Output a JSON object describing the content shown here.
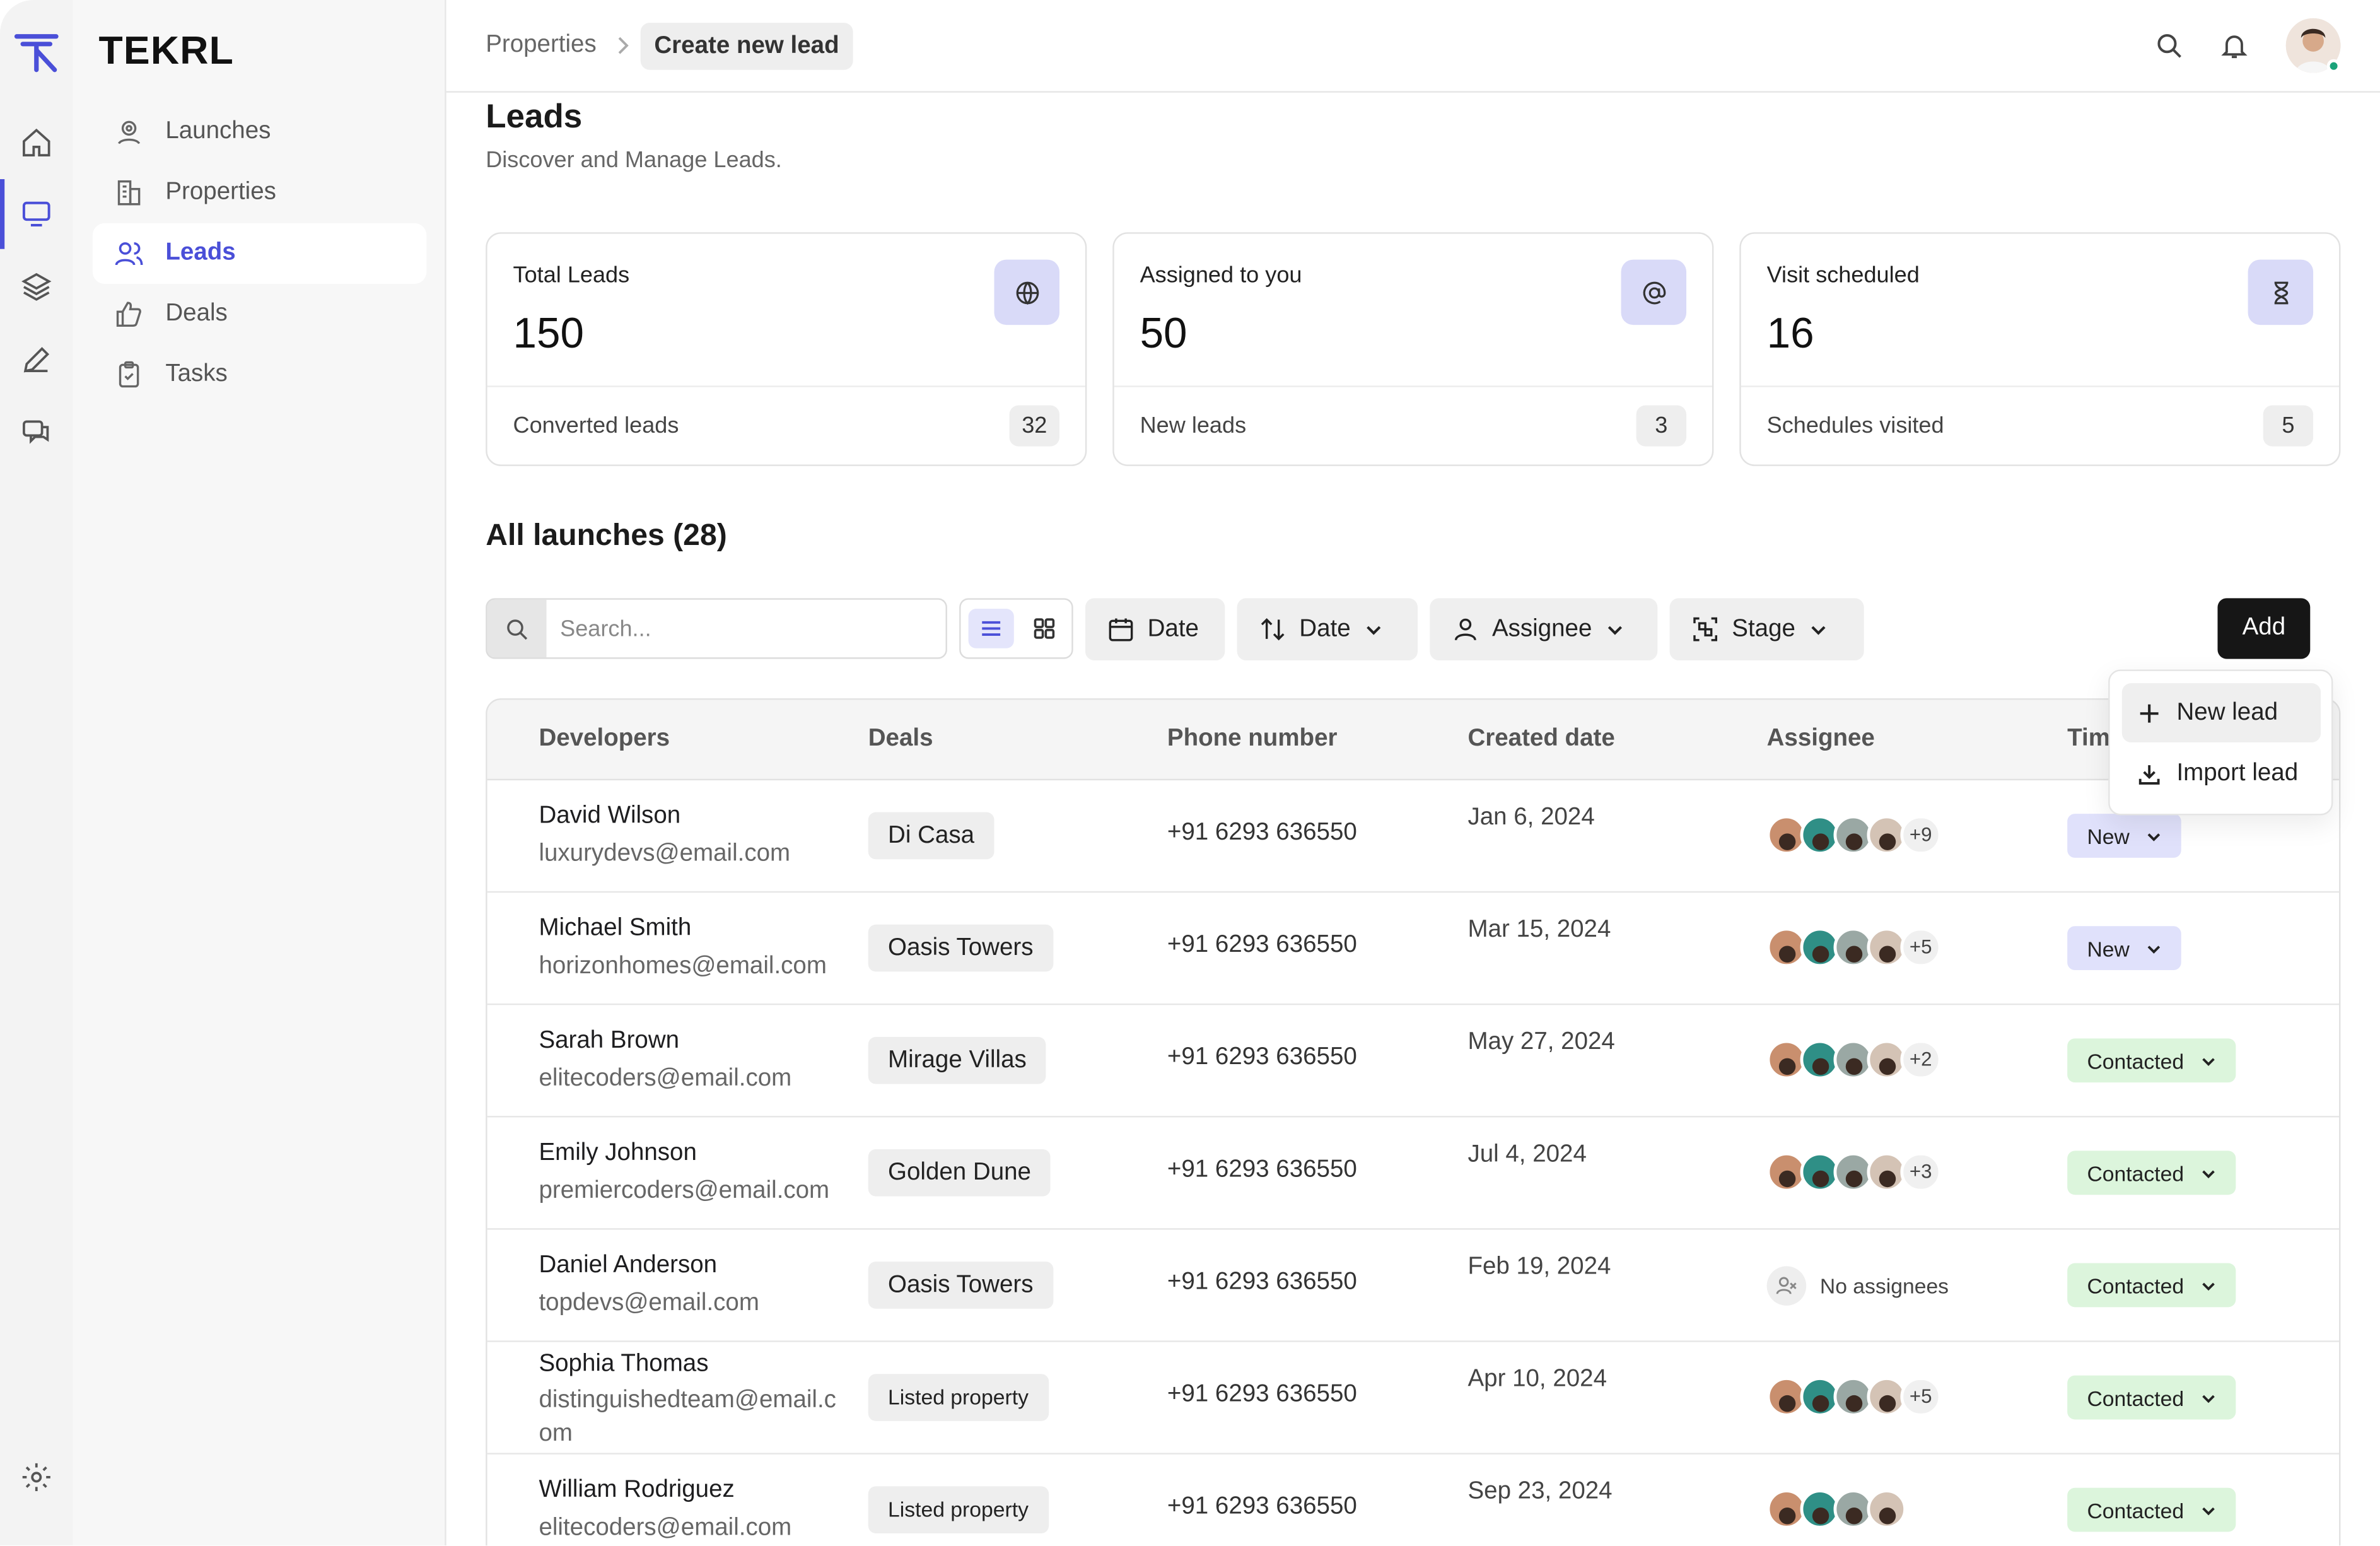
{
  "app": {
    "brand": "TEKRL"
  },
  "sidebar": {
    "items": [
      {
        "label": "Launches",
        "icon": "map-pin-icon"
      },
      {
        "label": "Properties",
        "icon": "building-icon"
      },
      {
        "label": "Leads",
        "icon": "users-icon",
        "active": true
      },
      {
        "label": "Deals",
        "icon": "thumbs-up-icon"
      },
      {
        "label": "Tasks",
        "icon": "clipboard-check-icon"
      }
    ]
  },
  "rail": {
    "icons": [
      "home-icon",
      "monitor-icon",
      "layers-icon",
      "pen-icon",
      "chat-icon",
      "settings-icon"
    ]
  },
  "header": {
    "breadcrumb": {
      "parent": "Properties",
      "current": "Create new lead"
    }
  },
  "page": {
    "title": "Leads",
    "subtitle": "Discover and Manage Leads."
  },
  "cards": [
    {
      "label": "Total Leads",
      "value": "150",
      "icon": "globe-icon",
      "footer": "Converted leads",
      "count": "32"
    },
    {
      "label": "Assigned to you",
      "value": "50",
      "icon": "at-sign-icon",
      "footer": "New leads",
      "count": "3"
    },
    {
      "label": "Visit scheduled",
      "value": "16",
      "icon": "hourglass-icon",
      "footer": "Schedules visited",
      "count": "5"
    }
  ],
  "list": {
    "title": "All launches (28)",
    "search_placeholder": "Search...",
    "filters": {
      "date": "Date",
      "sort_date": "Date",
      "assignee": "Assignee",
      "stage": "Stage"
    },
    "add_label": "Add"
  },
  "add_menu": {
    "items": [
      {
        "label": "New lead",
        "icon": "plus-icon"
      },
      {
        "label": "Import lead",
        "icon": "download-icon"
      }
    ]
  },
  "table": {
    "headers": [
      "Developers",
      "Deals",
      "Phone number",
      "Created date",
      "Assignee",
      "Tim"
    ],
    "rows": [
      {
        "name": "David Wilson",
        "email": "luxurydevs@email.com",
        "deal": "Di Casa",
        "phone": "+91 6293 636550",
        "date": "Jan 6, 2024",
        "more": "+9",
        "stage": "New"
      },
      {
        "name": "Michael Smith",
        "email": "horizonhomes@email.com",
        "deal": "Oasis Towers",
        "phone": "+91 6293 636550",
        "date": "Mar 15, 2024",
        "more": "+5",
        "stage": "New"
      },
      {
        "name": "Sarah Brown",
        "email": "elitecoders@email.com",
        "deal": "Mirage Villas",
        "phone": "+91 6293 636550",
        "date": "May 27, 2024",
        "more": "+2",
        "stage": "Contacted"
      },
      {
        "name": "Emily Johnson",
        "email": "premiercoders@email.com",
        "deal": "Golden Dune",
        "phone": "+91 6293 636550",
        "date": "Jul 4, 2024",
        "more": "+3",
        "stage": "Contacted"
      },
      {
        "name": "Daniel Anderson",
        "email": "topdevs@email.com",
        "deal": "Oasis Towers",
        "phone": "+91 6293 636550",
        "date": "Feb 19, 2024",
        "no_assignees": "No assignees",
        "stage": "Contacted"
      },
      {
        "name": "Sophia Thomas",
        "email": "distinguishedteam@email.com",
        "deal": "Listed property",
        "phone": "+91 6293 636550",
        "date": "Apr 10, 2024",
        "more": "+5",
        "stage": "Contacted"
      },
      {
        "name": "William Rodriguez",
        "email": "elitecoders@email.com",
        "deal": "Listed property",
        "phone": "+91 6293 636550",
        "date": "Sep 23, 2024",
        "more": "",
        "stage": "Contacted"
      }
    ]
  },
  "colors": {
    "accent": "#4a4fd8",
    "new_badge": "#e0e1fb",
    "contacted_badge": "#dcf5dc",
    "online": "#1aa37a"
  }
}
